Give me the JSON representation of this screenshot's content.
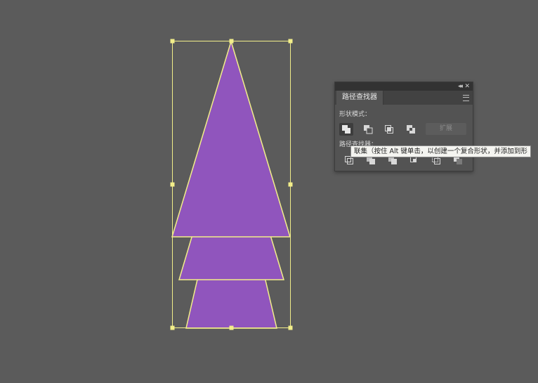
{
  "colors": {
    "canvas_bg": "#5b5b5b",
    "shape_fill": "#9055bd",
    "selection_stroke": "#f2ee8a"
  },
  "panel": {
    "title": "路径查找器",
    "icons": {
      "collapse": "double-chevron-left-icon",
      "close": "close-icon",
      "menu": "hamburger-menu-icon"
    },
    "shape_modes_label": "形状模式：",
    "shape_modes": [
      {
        "name": "unite",
        "icon": "unite-icon",
        "active": true
      },
      {
        "name": "minus-front",
        "icon": "minus-front-icon",
        "active": false
      },
      {
        "name": "intersect",
        "icon": "intersect-icon",
        "active": false
      },
      {
        "name": "exclude",
        "icon": "exclude-icon",
        "active": false
      }
    ],
    "expand_label": "扩展",
    "pathfinders_label": "路径查找器：",
    "pathfinders": [
      {
        "name": "divide",
        "icon": "divide-icon"
      },
      {
        "name": "trim",
        "icon": "trim-icon"
      },
      {
        "name": "merge",
        "icon": "merge-icon"
      },
      {
        "name": "crop",
        "icon": "crop-icon"
      },
      {
        "name": "outline",
        "icon": "outline-icon"
      },
      {
        "name": "minus-back",
        "icon": "minus-back-icon"
      }
    ]
  },
  "tooltip": {
    "text": "联集（按住 Alt 键单击，以创建一个复合形状，并添加到形"
  }
}
